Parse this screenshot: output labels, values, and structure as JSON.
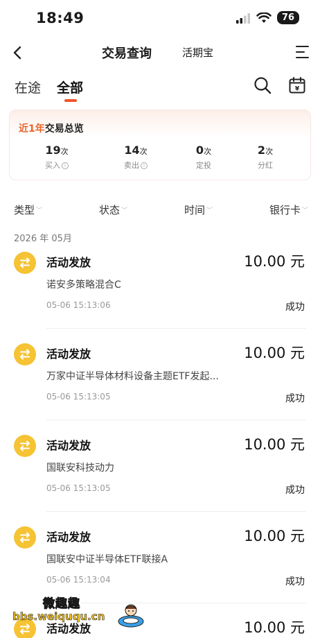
{
  "status_bar": {
    "time": "18:49",
    "battery": "76"
  },
  "nav": {
    "title": "交易查询",
    "subtitle": "活期宝"
  },
  "tabs": [
    {
      "label": "在途"
    },
    {
      "label": "全部"
    }
  ],
  "summary": {
    "title_highlight": "近1年",
    "title_rest": "交易总览",
    "stats": [
      {
        "value": "19",
        "unit": "次",
        "label": "买入"
      },
      {
        "value": "14",
        "unit": "次",
        "label": "卖出"
      },
      {
        "value": "0",
        "unit": "次",
        "label": "定投"
      },
      {
        "value": "2",
        "unit": "次",
        "label": "分红"
      }
    ]
  },
  "filters": [
    "类型",
    "状态",
    "时间",
    "银行卡"
  ],
  "month": "2026 年 05月",
  "records": [
    {
      "title": "活动发放",
      "amount": "10.00 元",
      "fund": "诺安多策略混合C",
      "time": "05-06 15:13:06",
      "status": "成功"
    },
    {
      "title": "活动发放",
      "amount": "10.00 元",
      "fund": "万家中证半导体材料设备主题ETF发起...",
      "time": "05-06 15:13:05",
      "status": "成功"
    },
    {
      "title": "活动发放",
      "amount": "10.00 元",
      "fund": "国联安科技动力",
      "time": "05-06 15:13:05",
      "status": "成功"
    },
    {
      "title": "活动发放",
      "amount": "10.00 元",
      "fund": "国联安中证半导体ETF联接A",
      "time": "05-06 15:13:04",
      "status": "成功"
    },
    {
      "title": "活动发放",
      "amount": "10.00 元",
      "fund": "",
      "time": "",
      "status": ""
    }
  ],
  "watermark": {
    "top": "微趣趣",
    "bottom": "bbs.weiququ.cn"
  },
  "colors": {
    "accent": "#f0542d",
    "summary_highlight": "#e8642c",
    "record_icon": "#f5c333"
  }
}
